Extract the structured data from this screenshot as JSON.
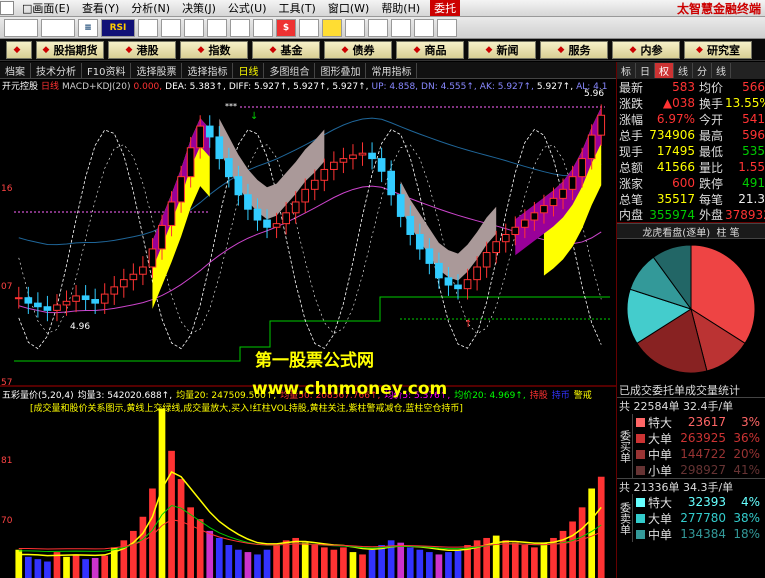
{
  "menu": {
    "items": [
      "□画面(E)",
      "查看(Y)",
      "分析(N)",
      "决策(J)",
      "公式(U)",
      "工具(T)",
      "窗口(W)",
      "帮助(H)"
    ],
    "trade": "委托",
    "brand": "太智慧金融终端"
  },
  "iconbar": {
    "items": [
      "≡",
      "RSI",
      "$"
    ]
  },
  "nav": {
    "items": [
      "",
      "股指期货",
      "港股",
      "指数",
      "基金",
      "债券",
      "商品",
      "新闻",
      "服务",
      "内参",
      "研究室"
    ]
  },
  "tabs": {
    "items": [
      "档案",
      "技术分析",
      "F10资料",
      "选择股票",
      "选择指标",
      "日线",
      "多图组合",
      "图形叠加",
      "常用指标"
    ]
  },
  "chart": {
    "stock_name": "开元控股",
    "period": "日线",
    "indicator": "MACD+KDJ(20)",
    "top_readout": [
      {
        "t": "0.000,",
        "c": "#f33"
      },
      {
        "t": "DEA: 5.383↑,",
        "c": "#fff"
      },
      {
        "t": "DIFF: 5.927↑,",
        "c": "#fff"
      },
      {
        "t": "5.927↑,",
        "c": "#fff"
      },
      {
        "t": "5.927↑,",
        "c": "#fff"
      },
      {
        "t": "UP: 4.858,",
        "c": "#88f"
      },
      {
        "t": "DN: 4.555↑,",
        "c": "#88f"
      },
      {
        "t": "AK: 5.927↑,",
        "c": "#88f"
      },
      {
        "t": "5.927↑,",
        "c": "#fff"
      },
      {
        "t": "AL: 4.1",
        "c": "#88f"
      }
    ],
    "price_marker": "5.96",
    "low_marker": "4.96",
    "left_ticks": [
      "16",
      "07",
      "57"
    ],
    "vol_title": "五彩量价(5,20,4)",
    "vol_readout": [
      {
        "t": "均量3: 542020.688↑,",
        "c": "#fff"
      },
      {
        "t": "均量20: 247509.500↑,",
        "c": "#ff0"
      },
      {
        "t": "均量50: 208567.766↑,",
        "c": "#f33"
      },
      {
        "t": "均价5: 5.376↑,",
        "c": "#f0f"
      },
      {
        "t": "均价20: 4.969↑,",
        "c": "#0f0"
      },
      {
        "t": "持股",
        "c": "#f33"
      },
      {
        "t": "持币",
        "c": "#33f"
      },
      {
        "t": "警戒",
        "c": "#ff0"
      }
    ],
    "vol_note": "[成交量和股价关系图示,黄线上交绿线,成交量放大,买入!红柱VOL持股,黄柱关注,紫柱警戒减仓,蓝柱空仓持币]",
    "vol_ticks": [
      "81",
      "70"
    ],
    "watermark1": "第一股票公式网",
    "watermark2": "www.chnmoney.com"
  },
  "chart_data": {
    "type": "candlestick",
    "close": [
      4.95,
      4.92,
      4.9,
      4.88,
      4.91,
      4.93,
      4.96,
      4.94,
      4.92,
      4.97,
      5.01,
      5.05,
      5.08,
      5.12,
      5.22,
      5.35,
      5.48,
      5.62,
      5.78,
      5.9,
      5.84,
      5.72,
      5.62,
      5.52,
      5.44,
      5.38,
      5.34,
      5.36,
      5.42,
      5.48,
      5.55,
      5.6,
      5.66,
      5.7,
      5.72,
      5.74,
      5.75,
      5.72,
      5.65,
      5.52,
      5.4,
      5.3,
      5.22,
      5.14,
      5.06,
      5.02,
      5.0,
      5.05,
      5.12,
      5.2,
      5.26,
      5.3,
      5.34,
      5.38,
      5.42,
      5.46,
      5.5,
      5.55,
      5.62,
      5.72,
      5.85,
      5.96
    ],
    "volume": [
      120,
      90,
      80,
      70,
      110,
      90,
      100,
      80,
      85,
      95,
      130,
      160,
      200,
      260,
      380,
      720,
      540,
      420,
      300,
      250,
      200,
      170,
      140,
      120,
      110,
      100,
      120,
      140,
      160,
      170,
      150,
      140,
      130,
      120,
      130,
      110,
      100,
      120,
      140,
      160,
      150,
      130,
      120,
      110,
      100,
      110,
      120,
      140,
      160,
      170,
      180,
      160,
      150,
      140,
      130,
      150,
      170,
      200,
      240,
      300,
      380,
      430
    ],
    "vol_ma_yellow": [
      100,
      100,
      98,
      95,
      96,
      97,
      98,
      97,
      96,
      98,
      110,
      125,
      150,
      190,
      260,
      380,
      450,
      430,
      380,
      330,
      280,
      240,
      210,
      185,
      165,
      150,
      145,
      145,
      150,
      155,
      155,
      150,
      145,
      140,
      138,
      132,
      125,
      122,
      125,
      132,
      136,
      135,
      132,
      128,
      122,
      118,
      118,
      122,
      130,
      140,
      150,
      155,
      155,
      152,
      148,
      148,
      152,
      162,
      180,
      210,
      250,
      300
    ]
  },
  "quote": {
    "rows": [
      {
        "l1": "最新",
        "v1": "583",
        "c1": "red",
        "l2": "均价",
        "v2": "566",
        "c2": "red"
      },
      {
        "l1": "涨跌",
        "v1": "▲038",
        "c1": "red",
        "l2": "换手",
        "v2": "13.55%",
        "c2": "yel"
      },
      {
        "l1": "涨幅",
        "v1": "6.97%",
        "c1": "red",
        "l2": "今开",
        "v2": "541",
        "c2": "red"
      },
      {
        "l1": "总手",
        "v1": "734906",
        "c1": "yel",
        "l2": "最高",
        "v2": "596",
        "c2": "red"
      },
      {
        "l1": "现手",
        "v1": "17495",
        "c1": "yel",
        "l2": "最低",
        "v2": "535",
        "c2": "grn"
      },
      {
        "l1": "总额",
        "v1": "41566",
        "c1": "yel",
        "l2": "量比",
        "v2": "1.55",
        "c2": "red"
      },
      {
        "l1": "涨家",
        "v1": "600",
        "c1": "red",
        "l2": "跌停",
        "v2": "491",
        "c2": "grn"
      },
      {
        "l1": "总笔",
        "v1": "35517",
        "c1": "yel",
        "l2": "每笔",
        "v2": "21.3",
        "c2": "wht"
      },
      {
        "l1": "内盘",
        "v1": "355974",
        "c1": "grn",
        "l2": "外盘",
        "v2": "378932",
        "c2": "red"
      }
    ],
    "tabs": [
      "标",
      "日",
      "权",
      "线",
      "分",
      "线"
    ],
    "dragon": "龙虎看盘(逐单)",
    "dragon_tabs": "柱 笔",
    "pie_slices": [
      34,
      12,
      20,
      14,
      10,
      10
    ],
    "stat_title": "已成交委托单成交量统计",
    "buy_total": "共 22584单 32.4手/单",
    "buy_label": "委买单",
    "buy_rows": [
      {
        "n": "特大",
        "v": "23617",
        "p": "3%",
        "c": "#f66"
      },
      {
        "n": "大单",
        "v": "263925",
        "p": "36%",
        "c": "#c33"
      },
      {
        "n": "中单",
        "v": "144722",
        "p": "20%",
        "c": "#933"
      },
      {
        "n": "小单",
        "v": "298927",
        "p": "41%",
        "c": "#633"
      }
    ],
    "sell_total": "共 21336单 34.3手/单",
    "sell_label": "委卖单",
    "sell_rows": [
      {
        "n": "特大",
        "v": "32393",
        "p": "4%",
        "c": "#6ff"
      },
      {
        "n": "大单",
        "v": "277780",
        "p": "38%",
        "c": "#3cc"
      },
      {
        "n": "中单",
        "v": "134384",
        "p": "18%",
        "c": "#399"
      }
    ]
  }
}
